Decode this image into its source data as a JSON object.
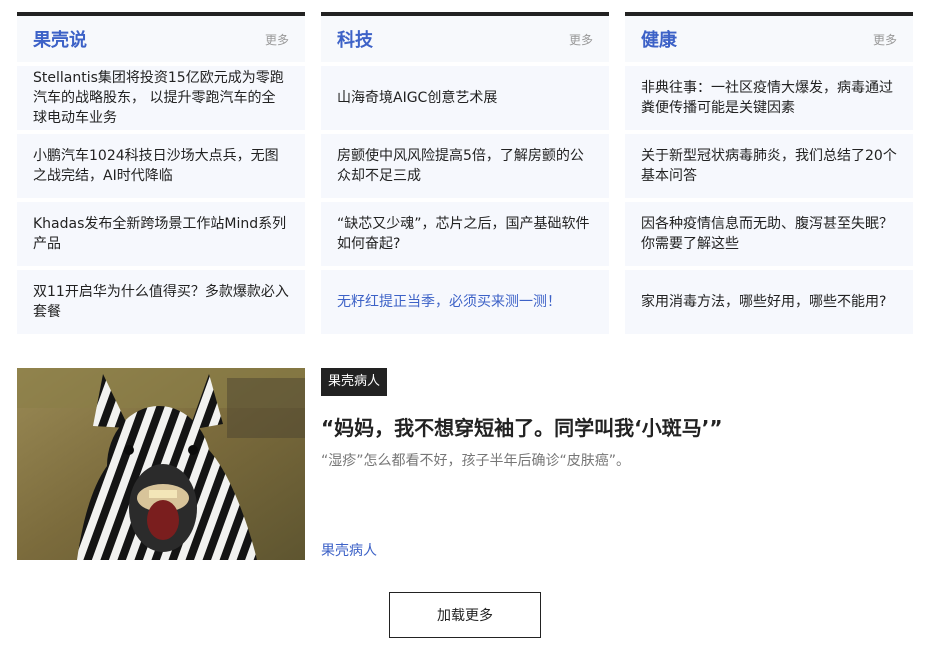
{
  "columns": [
    {
      "title": "果壳说",
      "more": "更多",
      "items": [
        "Stellantis集团将投资15亿欧元成为零跑汽车的战略股东， 以提升零跑汽车的全球电动车业务",
        "小鹏汽车1024科技日沙场大点兵，无图之战完结，AI时代降临",
        "Khadas发布全新跨场景工作站Mind系列产品",
        "双11开启华为什么值得买？多款爆款必入套餐"
      ]
    },
    {
      "title": "科技",
      "more": "更多",
      "items": [
        "山海奇境AIGC创意艺术展",
        "房颤使中风风险提高5倍，了解房颤的公众却不足三成",
        "“缺芯又少魂”，芯片之后，国产基础软件如何奋起?",
        "无籽红提正当季，必须买来测一测！"
      ]
    },
    {
      "title": "健康",
      "more": "更多",
      "items": [
        "非典往事：一社区疫情大爆发，病毒通过粪便传播可能是关键因素",
        "关于新型冠状病毒肺炎，我们总结了20个基本问答",
        "因各种疫情信息而无助、腹泻甚至失眠？你需要了解这些",
        "家用消毒方法，哪些好用，哪些不能用?"
      ]
    }
  ],
  "article": {
    "tag": "果壳病人",
    "title": "“妈妈，我不想穿短袖了。同学叫我‘小斑马’”",
    "description": "“湿疹”怎么都看不好，孩子半年后确诊“皮肤癌”。",
    "source": "果壳病人"
  },
  "load_more": "加载更多",
  "colors": {
    "accent": "#3d62c7",
    "dark": "#222222",
    "muted": "#999999",
    "item_bg": "#f6f8fd"
  }
}
